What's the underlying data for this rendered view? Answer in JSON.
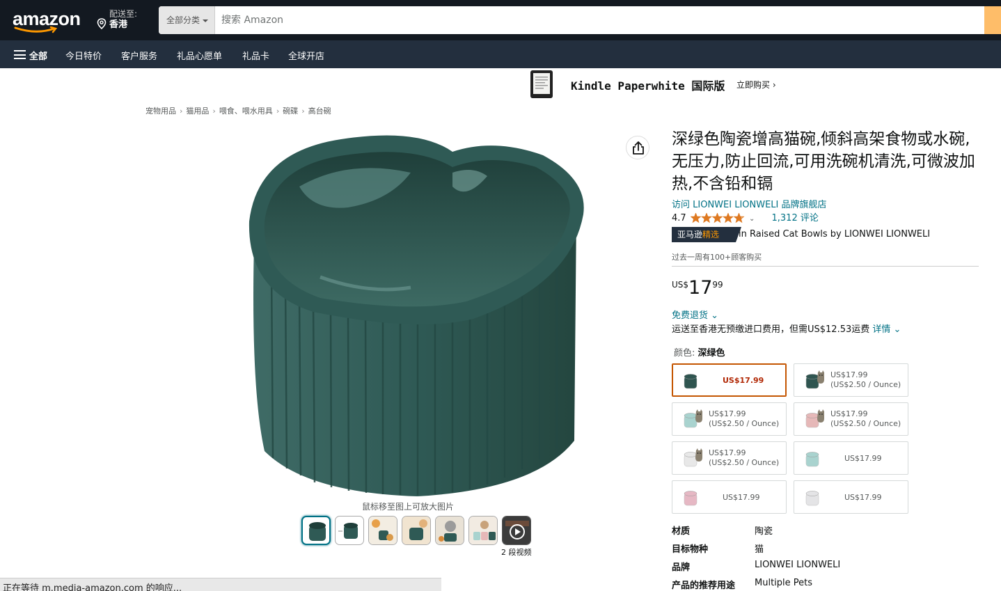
{
  "header": {
    "logo_text": "amazon",
    "deliver_line1": "配送至:",
    "deliver_line2": "香港",
    "search_category": "全部分类",
    "search_placeholder": "搜索 Amazon"
  },
  "nav": {
    "all": "全部",
    "items": [
      "今日特价",
      "客户服务",
      "礼品心愿单",
      "礼品卡",
      "全球开店"
    ]
  },
  "banner": {
    "title": "Kindle Paperwhite 国际版",
    "cta": "立即购买 ›"
  },
  "breadcrumb": [
    "宠物用品",
    "猫用品",
    "喂食、喂水用具",
    "碗碟",
    "高台碗"
  ],
  "gallery": {
    "zoom_hint": "鼠标移至图上可放大图片",
    "video_label": "2 段视频"
  },
  "loading_status": "正在等待 m.media-amazon.com 的响应...",
  "product": {
    "title": "深绿色陶瓷增高猫碗,倾斜高架食物或水碗,无压力,防止回流,可用洗碗机清洗,可微波加热,不含铅和镉",
    "store_link": "访问 LIONWEI LIONWELI 品牌旗舰店",
    "rating": "4.7",
    "rating_fraction": 0.94,
    "reviews": "1,312 评论",
    "choice_prefix": "亚马逊",
    "choice_accent": "精选",
    "choice_text": "in Raised Cat Bowls by LIONWEI LIONWELI",
    "bought": "过去一周有100+顾客购买",
    "price_currency": "US$",
    "price_whole": "17",
    "price_fraction": "99",
    "returns": "免费退货 ⌄",
    "shipping_text": "运送至香港无预缴进口费用，但需US$12.53运费 ",
    "shipping_link": "详情 ⌄",
    "color_label": "颜色: ",
    "color_value": "深绿色"
  },
  "swatches": [
    {
      "line1": "US$17.99",
      "line2": "",
      "color": "#2f5550",
      "cat": false
    },
    {
      "line1": "US$17.99",
      "line2": "(US$2.50 / Ounce)",
      "color": "#2f5550",
      "cat": true
    },
    {
      "line1": "US$17.99",
      "line2": "(US$2.50 / Ounce)",
      "color": "#a9d3cf",
      "cat": true
    },
    {
      "line1": "US$17.99",
      "line2": "(US$2.50 / Ounce)",
      "color": "#e6b8b8",
      "cat": true
    },
    {
      "line1": "US$17.99",
      "line2": "(US$2.50 / Ounce)",
      "color": "#e8e8e8",
      "cat": true
    },
    {
      "line1": "US$17.99",
      "line2": "",
      "color": "#a9d3cf",
      "cat": false
    },
    {
      "line1": "US$17.99",
      "line2": "",
      "color": "#e6b8c4",
      "cat": false
    },
    {
      "line1": "US$17.99",
      "line2": "",
      "color": "#e4e4e6",
      "cat": false
    }
  ],
  "specs": [
    {
      "k": "材质",
      "v": "陶瓷"
    },
    {
      "k": "目标物种",
      "v": "猫"
    },
    {
      "k": "品牌",
      "v": "LIONWEI LIONWELI"
    },
    {
      "k": "产品的推荐用途",
      "v": "Multiple Pets"
    }
  ],
  "colors": {
    "topbar": "#131921",
    "navbar": "#232f3e",
    "link": "#007185",
    "accent": "#ff9900",
    "price_red": "#b12704",
    "bowl": "#2f5a55"
  }
}
